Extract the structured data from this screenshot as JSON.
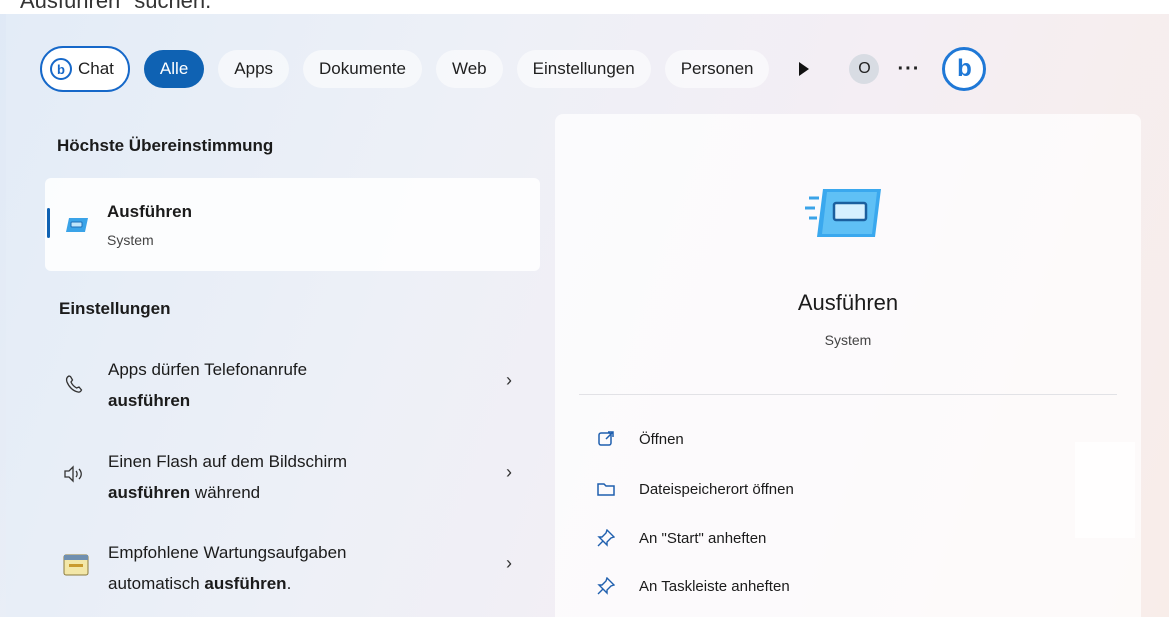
{
  "window": {
    "top_text": "Ausführen\" suchen."
  },
  "filters": {
    "chat": "Chat",
    "tabs": [
      {
        "label": "Alle",
        "active": true
      },
      {
        "label": "Apps",
        "active": false
      },
      {
        "label": "Dokumente",
        "active": false
      },
      {
        "label": "Web",
        "active": false
      },
      {
        "label": "Einstellungen",
        "active": false
      },
      {
        "label": "Personen",
        "active": false
      }
    ],
    "avatar_letter": "O",
    "more": "···",
    "bing_letter": "b"
  },
  "best_match": {
    "heading": "Höchste Übereinstimmung",
    "name": "Ausführen",
    "sub": "System"
  },
  "settings": {
    "heading": "Einstellungen",
    "items": [
      {
        "line1": "Apps dürfen Telefonanrufe",
        "line2_bold": "ausführen",
        "line2_rest": "",
        "icon": "phone-icon"
      },
      {
        "line1": "Einen Flash auf dem Bildschirm",
        "line2_bold": "ausführen",
        "line2_rest": " während",
        "icon": "speaker-icon"
      },
      {
        "line1": "Empfohlene Wartungsaufgaben",
        "line2_pre": "automatisch ",
        "line2_bold": "ausführen",
        "line2_rest": ".",
        "icon": "maintenance-icon"
      }
    ],
    "chevron": "›"
  },
  "detail": {
    "name": "Ausführen",
    "sub": "System",
    "actions": [
      {
        "label": "Öffnen",
        "icon": "open-external-icon"
      },
      {
        "label": "Dateispeicherort öffnen",
        "icon": "folder-icon"
      },
      {
        "label": "An \"Start\" anheften",
        "icon": "pin-icon"
      },
      {
        "label": "An Taskleiste anheften",
        "icon": "pin-icon"
      }
    ]
  },
  "colors": {
    "accent": "#0f62b3",
    "bing": "#1f78d6",
    "icon_blue": "#1f5fae"
  }
}
